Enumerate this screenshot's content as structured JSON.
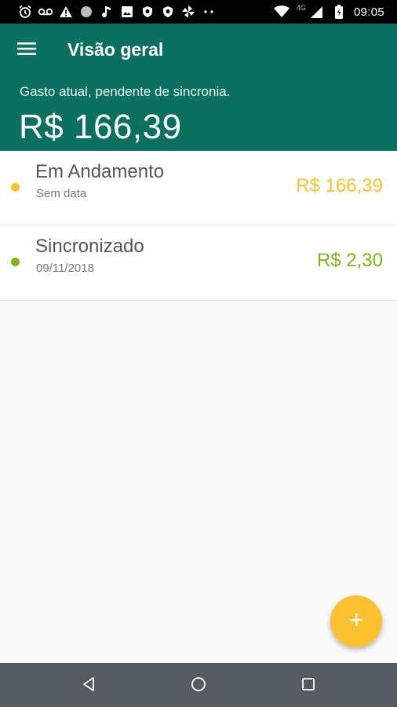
{
  "status_bar": {
    "time": "09:05",
    "network_label": "4G",
    "left_icons": [
      "alarm-icon",
      "voicemail-icon",
      "warning-icon",
      "circle-icon",
      "music-note-icon",
      "image-icon",
      "shield-icon",
      "shield-icon",
      "pinwheel-icon",
      "more-dots-icon"
    ],
    "right_icons": [
      "wifi-icon",
      "signal-icon",
      "battery-icon"
    ]
  },
  "app_bar": {
    "title": "Visão geral",
    "menu_icon": "menu-icon"
  },
  "summary": {
    "label": "Gasto atual, pendente de sincronia.",
    "amount": "R$ 166,39"
  },
  "entries": [
    {
      "title": "Em Andamento",
      "subtitle": "Sem data",
      "amount": "R$ 166,39",
      "color": "#fbc02d"
    },
    {
      "title": "Sincronizado",
      "subtitle": "09/11/2018",
      "amount": "R$ 2,30",
      "color": "#7cb518"
    }
  ],
  "fab": {
    "icon": "plus-icon",
    "color": "#fbc02d"
  },
  "nav_bar": {
    "icons": [
      "back-icon",
      "home-icon",
      "recents-icon"
    ]
  },
  "colors": {
    "primary": "#0b7060",
    "in_progress": "#fbc02d",
    "synced": "#7cb518"
  }
}
